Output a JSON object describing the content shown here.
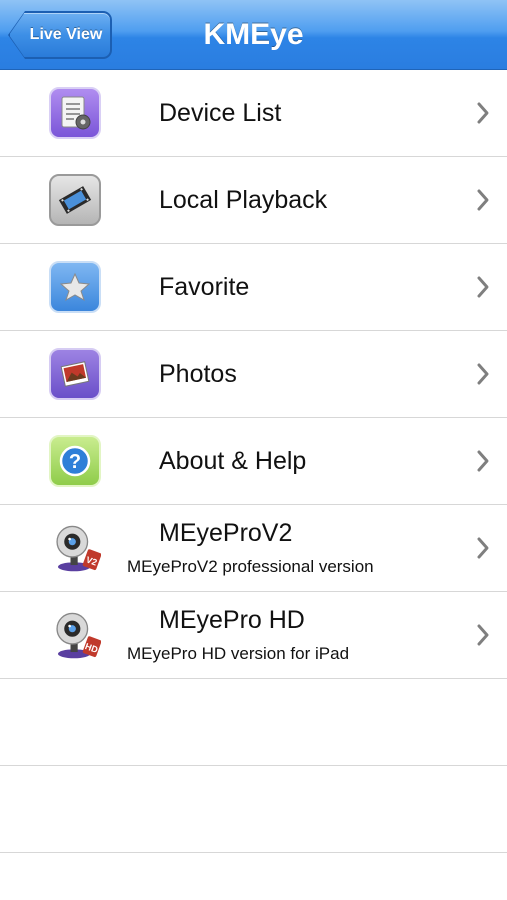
{
  "navbar": {
    "back_label": "Live View",
    "title": "KMEye"
  },
  "menu": [
    {
      "label": "Device List",
      "icon": "device-list-icon"
    },
    {
      "label": "Local Playback",
      "icon": "film-strip-icon"
    },
    {
      "label": "Favorite",
      "icon": "star-icon"
    },
    {
      "label": "Photos",
      "icon": "photos-icon"
    },
    {
      "label": "About & Help",
      "icon": "help-icon"
    },
    {
      "label": "MEyeProV2",
      "sublabel": "MEyeProV2 professional version",
      "icon": "webcam-icon",
      "badge": "V2"
    },
    {
      "label": "MEyePro HD",
      "sublabel": "MEyePro HD version for iPad",
      "icon": "webcam-icon",
      "badge": "HD"
    }
  ],
  "colors": {
    "navbar": "#3a8ee8",
    "divider": "#d7d7d7",
    "chevron": "#7f7f7f"
  }
}
